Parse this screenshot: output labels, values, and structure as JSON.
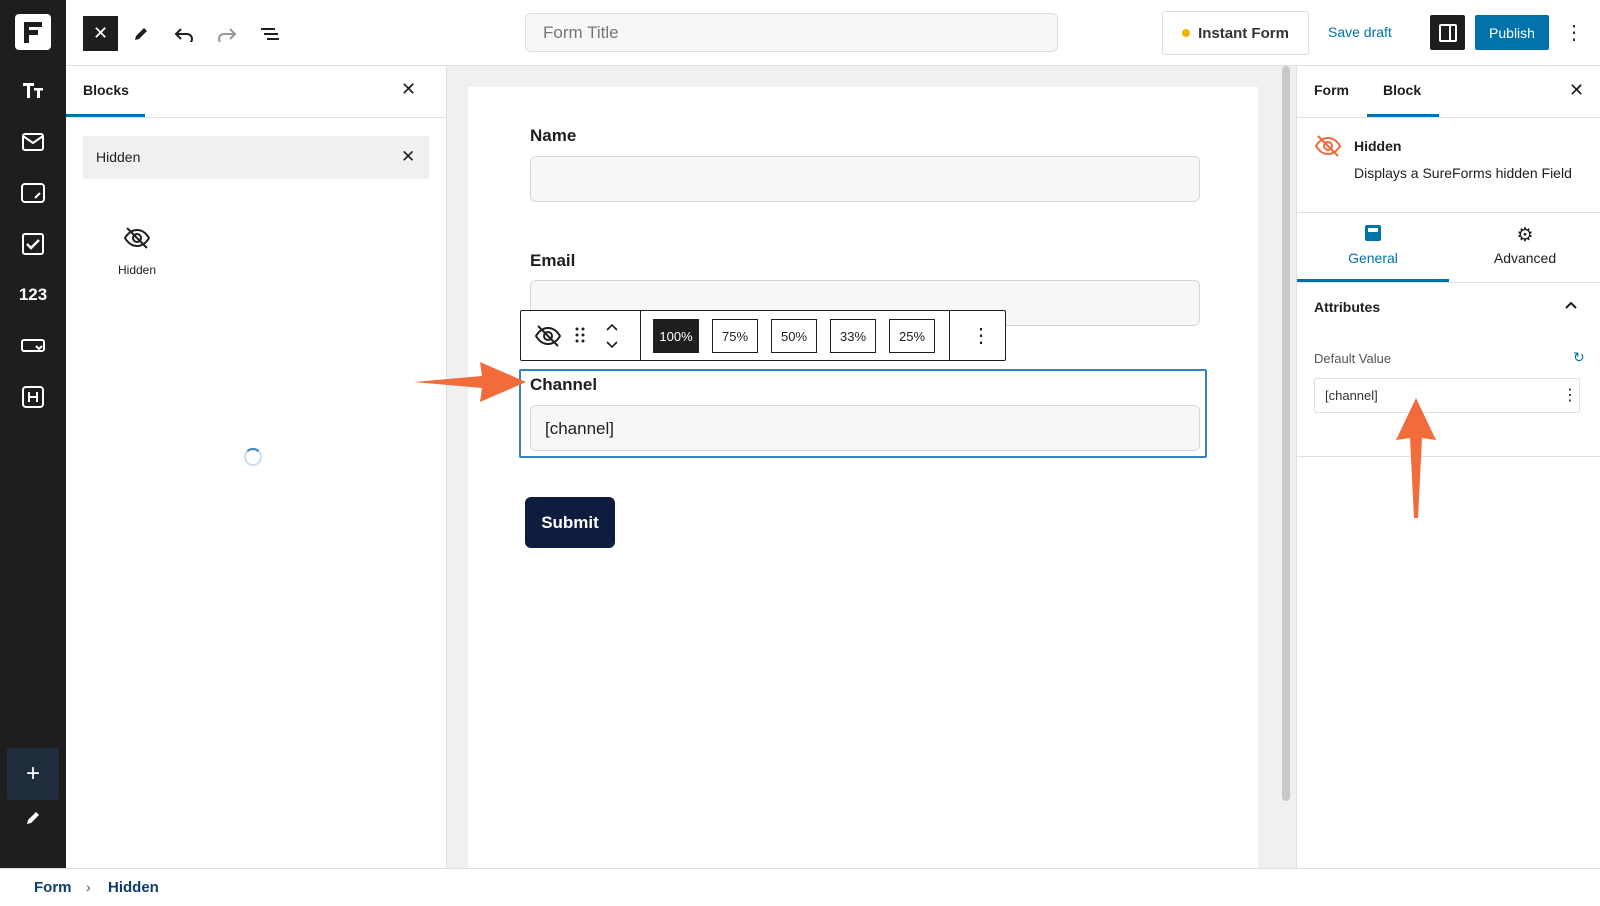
{
  "topbar": {
    "form_title_placeholder": "Form Title",
    "instant_form_label": "Instant Form",
    "save_draft_label": "Save draft",
    "publish_label": "Publish"
  },
  "rail": {
    "items": [
      "text-format-icon",
      "mail-icon",
      "input-box-icon",
      "checkbox-icon",
      "number-icon",
      "dropdown-icon",
      "heading-icon"
    ],
    "number_label": "123"
  },
  "blocks_panel": {
    "tab_label": "Blocks",
    "search_value": "Hidden",
    "results": [
      {
        "label": "Hidden",
        "icon": "eye-slash-icon"
      }
    ]
  },
  "canvas": {
    "fields": [
      {
        "label": "Name",
        "value": ""
      },
      {
        "label": "Email",
        "value": ""
      },
      {
        "label": "Channel",
        "value": "[channel]"
      }
    ],
    "submit_label": "Submit",
    "width_options": [
      "100%",
      "75%",
      "50%",
      "33%",
      "25%"
    ],
    "active_width": "100%"
  },
  "right_panel": {
    "tabs": [
      "Form",
      "Block"
    ],
    "active_tab": "Block",
    "block_title": "Hidden",
    "block_desc": "Displays a SureForms hidden Field",
    "sub_tabs": [
      "General",
      "Advanced"
    ],
    "active_sub_tab": "General",
    "section_title": "Attributes",
    "default_value_label": "Default Value",
    "default_value": "[channel]"
  },
  "breadcrumb": [
    "Form",
    "Hidden"
  ],
  "colors": {
    "accent": "#0073aa",
    "arrow": "#f26b3a",
    "dark": "#1e1e1e",
    "submit": "#0e1c3f"
  }
}
